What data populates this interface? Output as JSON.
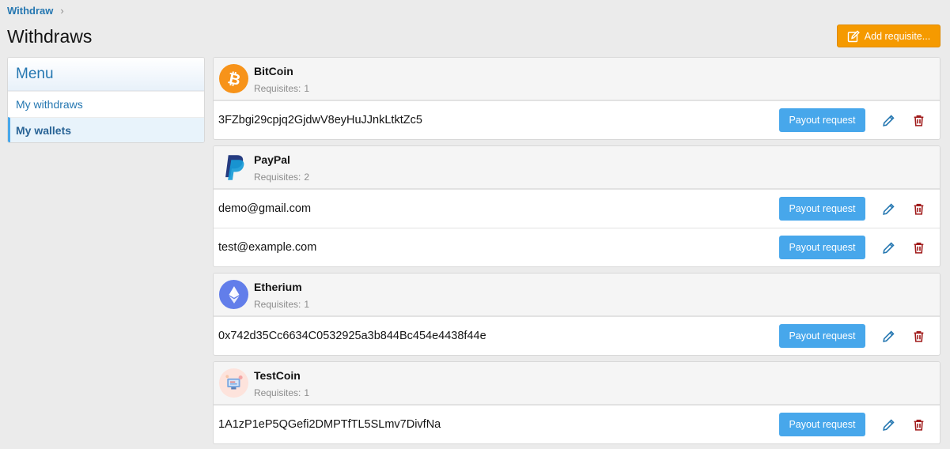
{
  "breadcrumb": {
    "root": "Withdraw",
    "separator": "›"
  },
  "page": {
    "title": "Withdraws"
  },
  "toolbar": {
    "add_label": "Add requisite..."
  },
  "menu": {
    "title": "Menu",
    "items": [
      {
        "label": "My withdraws",
        "active": false
      },
      {
        "label": "My wallets",
        "active": true
      }
    ]
  },
  "colors": {
    "accent": "#f59a00",
    "primary": "#47a7eb",
    "link": "#2577b1",
    "danger": "#a01b1b"
  },
  "wallets": [
    {
      "name": "BitCoin",
      "requisites_label": "Requisites:",
      "count": "1",
      "icon": "bitcoin-icon",
      "rows": [
        {
          "address": "3FZbgi29cpjq2GjdwV8eyHuJJnkLtktZc5",
          "payout_label": "Payout request"
        }
      ]
    },
    {
      "name": "PayPal",
      "requisites_label": "Requisites:",
      "count": "2",
      "icon": "paypal-icon",
      "rows": [
        {
          "address": "demo@gmail.com",
          "payout_label": "Payout request"
        },
        {
          "address": "test@example.com",
          "payout_label": "Payout request"
        }
      ]
    },
    {
      "name": "Etherium",
      "requisites_label": "Requisites:",
      "count": "1",
      "icon": "ethereum-icon",
      "rows": [
        {
          "address": "0x742d35Cc6634C0532925a3b844Bc454e4438f44e",
          "payout_label": "Payout request"
        }
      ]
    },
    {
      "name": "TestCoin",
      "requisites_label": "Requisites:",
      "count": "1",
      "icon": "testcoin-icon",
      "rows": [
        {
          "address": "1A1zP1eP5QGefi2DMPTfTL5SLmv7DivfNa",
          "payout_label": "Payout request"
        }
      ]
    }
  ]
}
